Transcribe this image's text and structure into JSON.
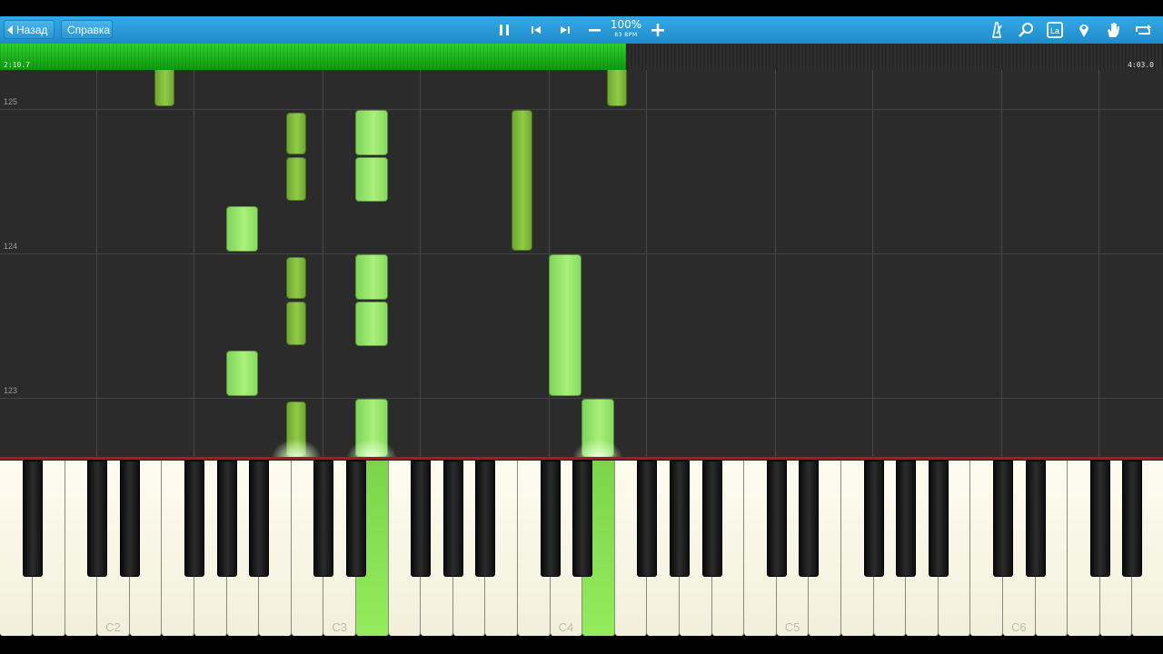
{
  "toolbar": {
    "back_label": "Назад",
    "help_label": "Справка",
    "zoom_value": "100%",
    "tempo_value": "83 BPM",
    "icons": [
      "pause-icon",
      "skip-back-icon",
      "skip-forward-icon",
      "minus-icon",
      "plus-icon",
      "metronome-icon",
      "search-icon",
      "label-icon",
      "location-pin-icon",
      "hand-icon",
      "loop-icon"
    ],
    "label_icon_text": "La"
  },
  "progress": {
    "current_time": "2:10.7",
    "total_time": "4:03.0",
    "fraction": 0.538
  },
  "roll": {
    "measure_numbers": [
      "125",
      "124",
      "123"
    ]
  },
  "keyboard": {
    "octave_labels": [
      "C2",
      "C3",
      "C4",
      "C5",
      "C6"
    ]
  },
  "colors": {
    "toolbar_blue": "#2a9ad8",
    "progress_green": "#1fb81f",
    "left_hand_note": "#7cb83a",
    "right_hand_note": "#9ee66c",
    "keyboard_line": "#b0161b"
  }
}
